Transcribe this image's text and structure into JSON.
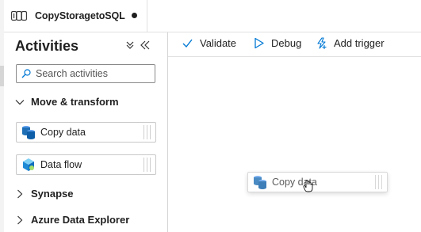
{
  "tab": {
    "title": "CopyStoragetoSQL",
    "icon": "pipeline-icon",
    "unsaved": true
  },
  "activities_pane": {
    "title": "Activities",
    "search": {
      "placeholder": "Search activities",
      "value": ""
    },
    "groups": [
      {
        "label": "Move & transform",
        "expanded": true,
        "items": [
          {
            "label": "Copy data",
            "icon": "copy-data-icon"
          },
          {
            "label": "Data flow",
            "icon": "data-flow-icon"
          }
        ]
      },
      {
        "label": "Synapse",
        "expanded": false
      },
      {
        "label": "Azure Data Explorer",
        "expanded": false
      }
    ]
  },
  "toolbar": {
    "validate_label": "Validate",
    "debug_label": "Debug",
    "add_trigger_label": "Add trigger"
  },
  "canvas": {
    "drag_item": {
      "label": "Copy data",
      "icon": "copy-data-icon"
    }
  },
  "colors": {
    "accent": "#0078d4",
    "icon_blue": "#1e6fb5",
    "text": "#1f1f1f"
  }
}
